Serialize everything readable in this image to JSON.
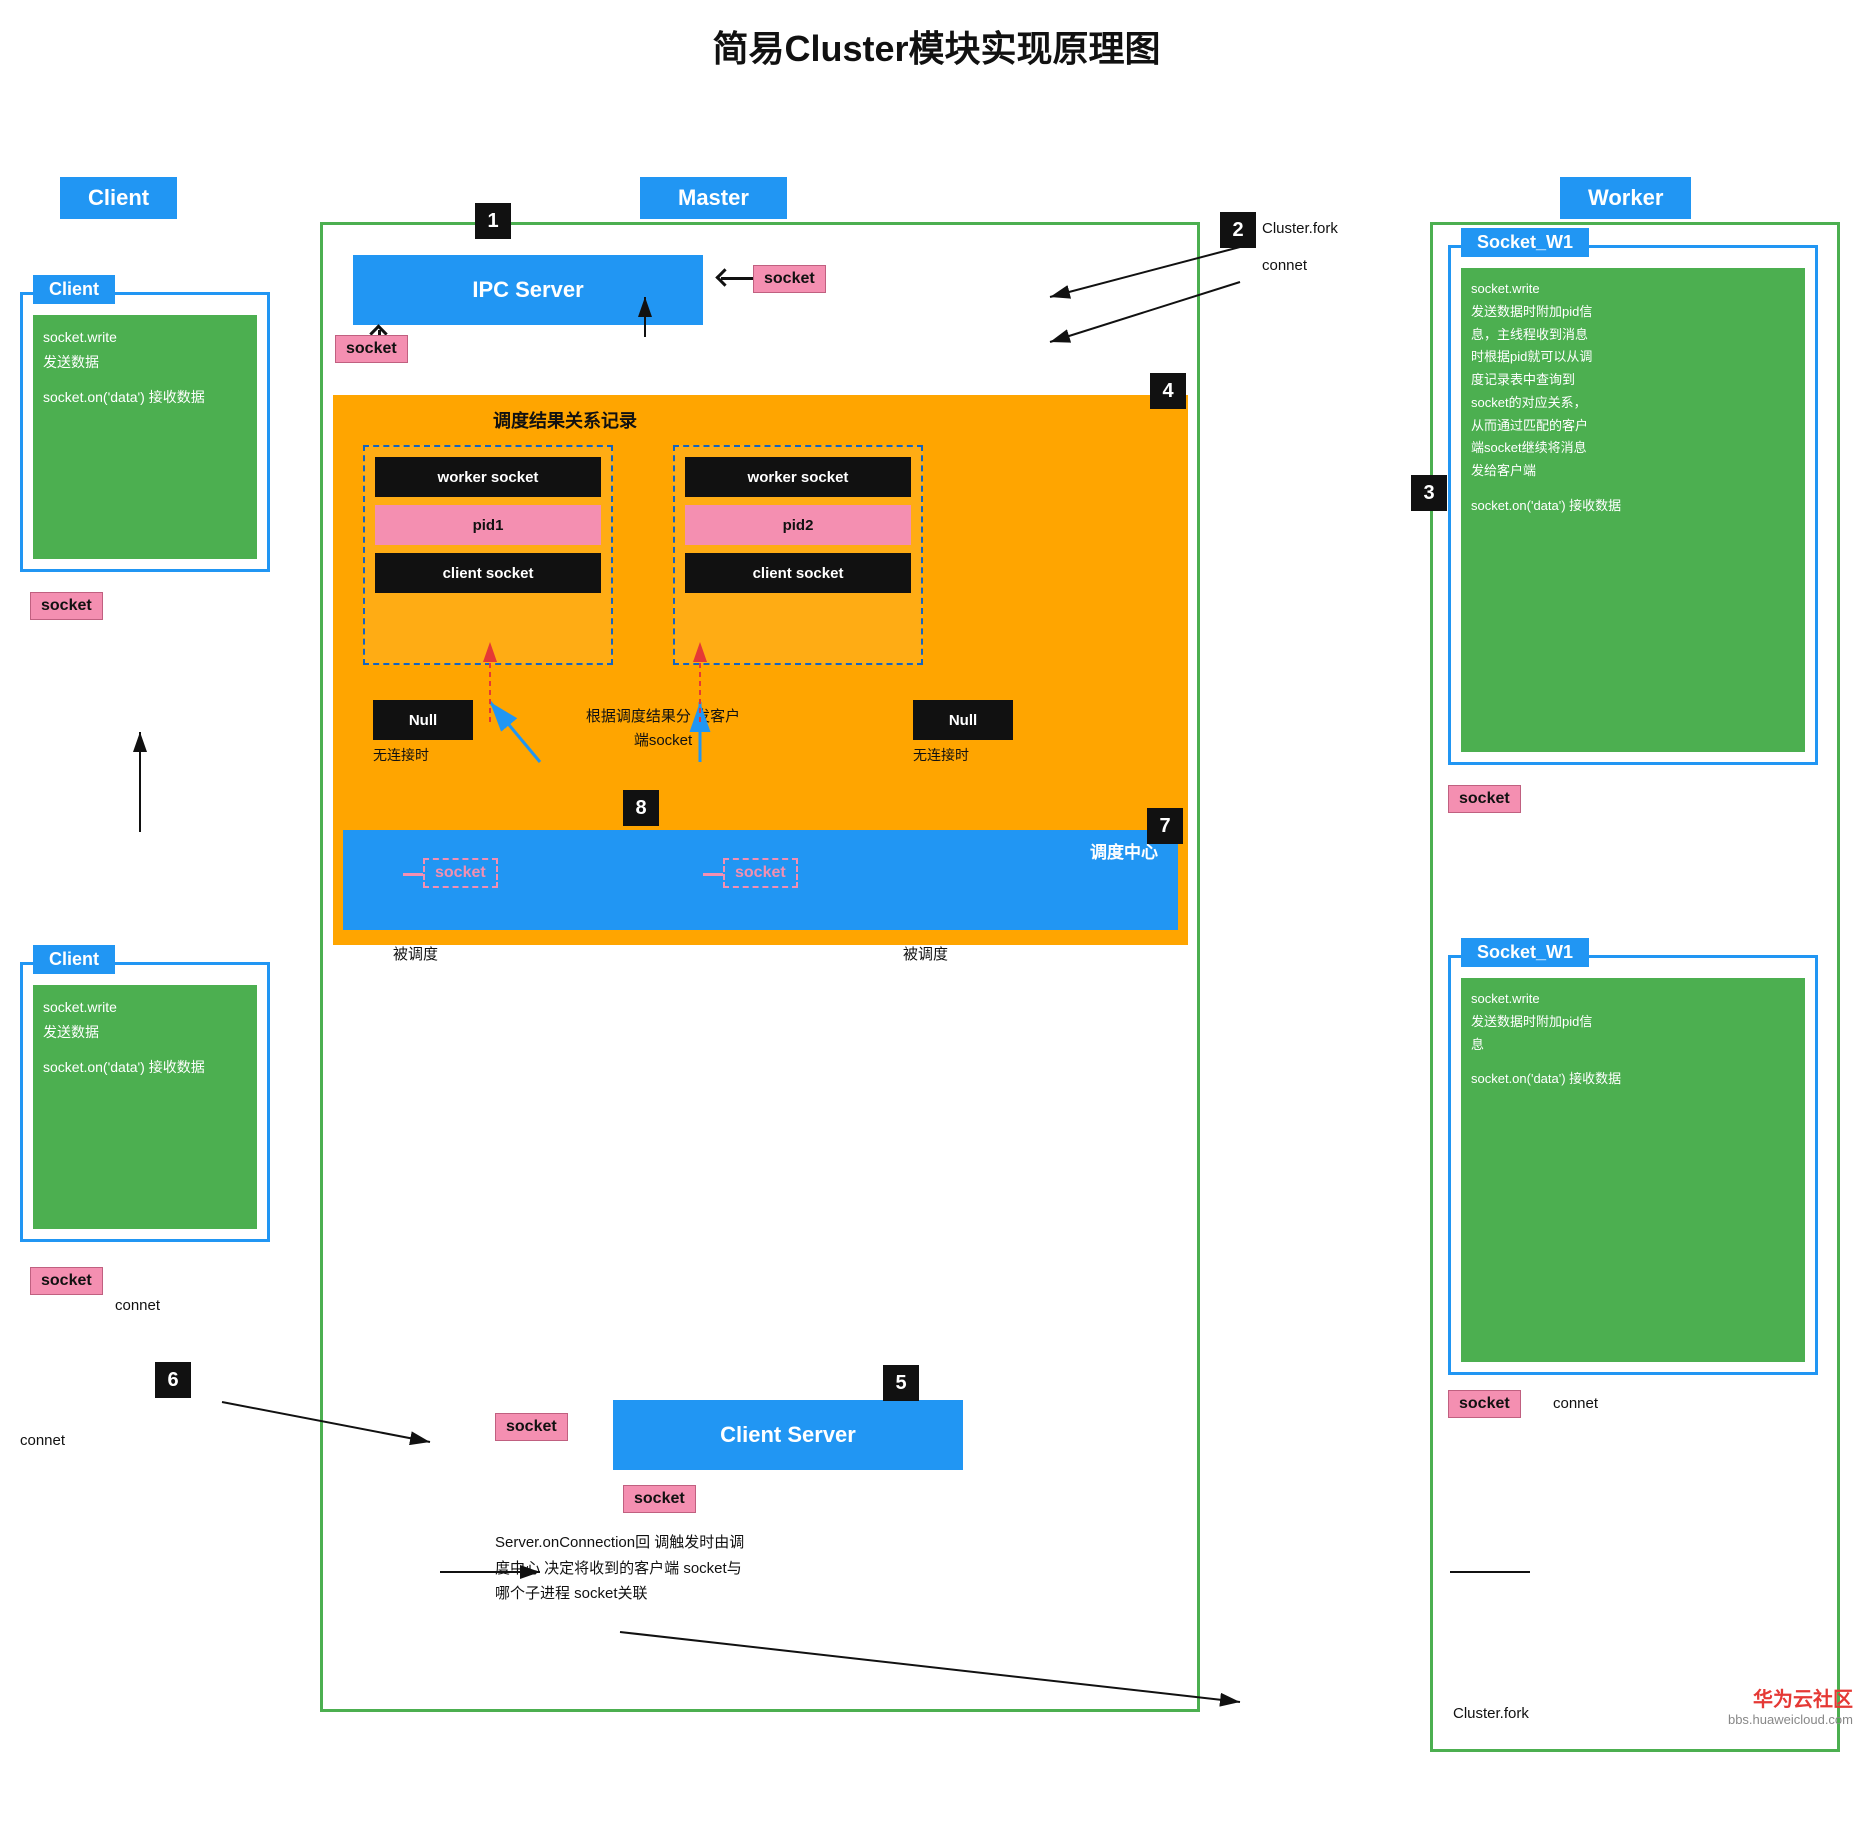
{
  "title": "简易Cluster模块实现原理图",
  "labels": {
    "client_header": "Client",
    "master_header": "Master",
    "worker_header": "Worker",
    "client1": "Client",
    "client2": "Client",
    "ipc_server": "IPC Server",
    "socket_w1_1": "Socket_W1",
    "socket_w1_2": "Socket_W1",
    "client_server": "Client Server",
    "schedule_center": "调度中心",
    "dispatch_record": "调度结果关系记录"
  },
  "badges": {
    "n1": "1",
    "n2": "2",
    "n3": "3",
    "n4": "4",
    "n5": "5",
    "n6": "6",
    "n7": "7",
    "n8": "8"
  },
  "socket_labels": [
    "socket",
    "socket",
    "socket",
    "socket",
    "socket",
    "socket",
    "socket",
    "socket",
    "socket",
    "socket"
  ],
  "text": {
    "client1_write": "socket.write\n发送数据",
    "client1_recv": "socket.on('data')\n接收数据",
    "client2_write": "socket.write\n发送数据",
    "client2_recv": "socket.on('data')\n接收数据",
    "worker1_write": "socket.write\n发送数据时附加pid信\n息，主线程收到消息\n时根据pid就可以从调\n度记录表中查询到\nsocket的对应关系，\n从而通过匹配的客户\n端socket继续将消息\n发给客户端",
    "worker1_recv": "socket.on('data')\n接收数据",
    "worker2_write": "socket.write\n发送数据时附加pid信\n息",
    "worker2_recv": "socket.on('data')\n接收数据",
    "null1": "Null",
    "null2": "Null",
    "no_conn1": "无连接时",
    "no_conn2": "无连接时",
    "dispatch_desc": "根据调度结果分\n发客户端socket",
    "server_conn_desc": "Server.onConnection回\n调触发时由调度中心\n决定将收到的客户端\nsocket与哪个子进程\nsocket关联",
    "cluster_fork1": "Cluster.fork",
    "connet1": "connet",
    "connet2": "connet",
    "connet3": "connet",
    "dispatch1": "被调度",
    "dispatch2": "被调度",
    "worker_pid1": "pid1",
    "worker_pid2": "pid2",
    "worker_socket1": "worker socket",
    "worker_socket2": "worker socket",
    "client_socket1": "client socket",
    "client_socket2": "client socket",
    "cluster_fork2": "Cluster.fork"
  },
  "watermark": {
    "line1": "华为云社区",
    "line2": "bbs.huaweicloud.com"
  }
}
